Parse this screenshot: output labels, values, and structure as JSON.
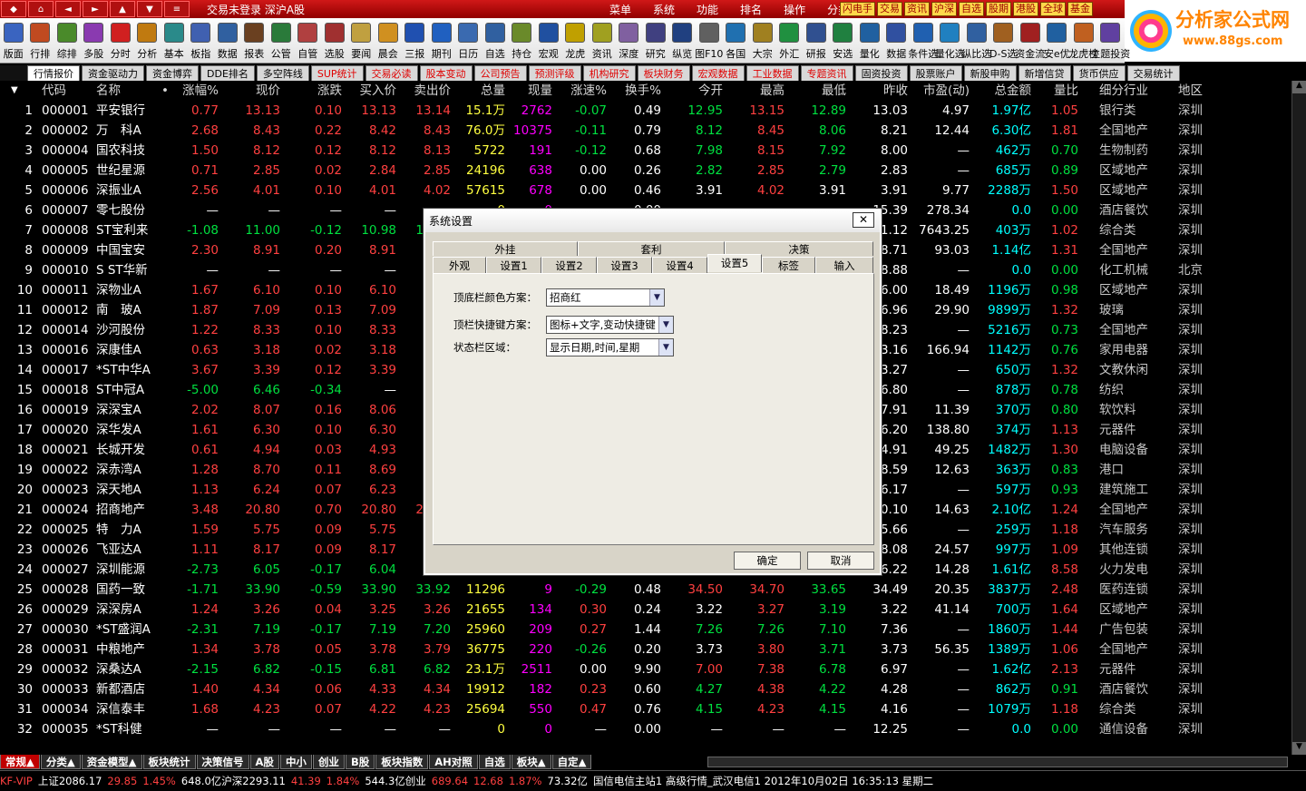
{
  "titlebar": {
    "app_title": "交易未登录   深沪A股",
    "nav_buttons": [
      "◆",
      "⌂",
      "◄",
      "►",
      "▲",
      "▼",
      "≡"
    ],
    "menus": [
      "菜单",
      "系统",
      "功能",
      "排名",
      "操作",
      "分类"
    ],
    "quick_buttons": [
      "闪电手",
      "交易",
      "资讯",
      "沪深",
      "自选",
      "股期",
      "港股",
      "全球",
      "基金"
    ]
  },
  "logo": {
    "name": "分析家公式网",
    "url": "www.88gs.com"
  },
  "toolbar": [
    {
      "label": "版面",
      "color": "#3a64c0"
    },
    {
      "label": "行排",
      "color": "#c04a20"
    },
    {
      "label": "综排",
      "color": "#4a8a2a"
    },
    {
      "label": "多股",
      "color": "#8a3ab0"
    },
    {
      "label": "分时",
      "color": "#d02020"
    },
    {
      "label": "分析",
      "color": "#c07a10"
    },
    {
      "label": "基本",
      "color": "#2a8a8a"
    },
    {
      "label": "板指",
      "color": "#4060b0"
    },
    {
      "label": "数据",
      "color": "#3060a0"
    },
    {
      "label": "报表",
      "color": "#6a4020"
    },
    {
      "label": "公管",
      "color": "#2a7a3a"
    },
    {
      "label": "自管",
      "color": "#b04040"
    },
    {
      "label": "选股",
      "color": "#a03030"
    },
    {
      "label": "要闻",
      "color": "#c0a040"
    },
    {
      "label": "晨会",
      "color": "#d09020"
    },
    {
      "label": "三报",
      "color": "#2050b0"
    },
    {
      "label": "期刊",
      "color": "#2060c0"
    },
    {
      "label": "日历",
      "color": "#3a6ab0"
    },
    {
      "label": "自选",
      "color": "#3060a0"
    },
    {
      "label": "持仓",
      "color": "#6a8a2a"
    },
    {
      "label": "宏观",
      "color": "#2050a0"
    },
    {
      "label": "龙虎",
      "color": "#c0a000"
    },
    {
      "label": "资讯",
      "color": "#a0a020"
    },
    {
      "label": "深度",
      "color": "#8060a0"
    },
    {
      "label": "研究",
      "color": "#404080"
    },
    {
      "label": "纵览",
      "color": "#204080"
    },
    {
      "label": "图F10",
      "color": "#606060"
    },
    {
      "label": "各国",
      "color": "#2070b0"
    },
    {
      "label": "大宗",
      "color": "#a08020"
    },
    {
      "label": "外汇",
      "color": "#209040"
    },
    {
      "label": "研报",
      "color": "#305090"
    },
    {
      "label": "安选",
      "color": "#208040"
    },
    {
      "label": "量化",
      "color": "#2060a0"
    },
    {
      "label": "数据",
      "color": "#3050a0"
    },
    {
      "label": "条件选",
      "color": "#2060b0"
    },
    {
      "label": "量化选",
      "color": "#2080c0"
    },
    {
      "label": "纵比选",
      "color": "#3060a0"
    },
    {
      "label": "D-S选",
      "color": "#a06020"
    },
    {
      "label": "资金流",
      "color": "#a02020"
    },
    {
      "label": "安e优",
      "color": "#2060a0"
    },
    {
      "label": "龙虎榜",
      "color": "#c06020"
    },
    {
      "label": "主题投资",
      "color": "#6040a0"
    }
  ],
  "tabs": [
    {
      "label": "行情报价",
      "active": true,
      "red": false
    },
    {
      "label": "资金驱动力",
      "active": false,
      "red": false
    },
    {
      "label": "资金博弈",
      "active": false,
      "red": false
    },
    {
      "label": "DDE排名",
      "active": false,
      "red": false
    },
    {
      "label": "多空阵线",
      "active": false,
      "red": false
    },
    {
      "label": "SUP统计",
      "active": false,
      "red": true
    },
    {
      "label": "交易必读",
      "active": false,
      "red": true
    },
    {
      "label": "股本变动",
      "active": false,
      "red": true
    },
    {
      "label": "公司预告",
      "active": false,
      "red": true
    },
    {
      "label": "预测评级",
      "active": false,
      "red": true
    },
    {
      "label": "机构研究",
      "active": false,
      "red": true
    },
    {
      "label": "板块财务",
      "active": false,
      "red": true
    },
    {
      "label": "宏观数据",
      "active": false,
      "red": true
    },
    {
      "label": "工业数据",
      "active": false,
      "red": true
    },
    {
      "label": "专题资讯",
      "active": false,
      "red": true
    },
    {
      "label": "固资投资",
      "active": false,
      "red": false
    },
    {
      "label": "股票账户",
      "active": false,
      "red": false
    },
    {
      "label": "新股申购",
      "active": false,
      "red": false
    },
    {
      "label": "新增信贷",
      "active": false,
      "red": false
    },
    {
      "label": "货币供应",
      "active": false,
      "red": false
    },
    {
      "label": "交易统计",
      "active": false,
      "red": false
    }
  ],
  "table": {
    "columns": [
      "",
      "代码",
      "名称",
      "•",
      "涨幅%",
      "现价",
      "涨跌",
      "买入价",
      "卖出价",
      "总量",
      "现量",
      "涨速%",
      "换手%",
      "今开",
      "最高",
      "最低",
      "昨收",
      "市盈(动)",
      "总金额",
      "量比",
      "细分行业",
      "地区"
    ],
    "rows": [
      [
        "1",
        "000001",
        "平安银行",
        "0.77",
        "13.13",
        "0.10",
        "13.13",
        "13.14",
        "15.1万",
        "2762",
        "-0.07",
        "0.49",
        "12.95",
        "13.15",
        "12.89",
        "13.03",
        "4.97",
        "1.97亿",
        "1.05",
        "银行类",
        "深圳"
      ],
      [
        "2",
        "000002",
        "万　科A",
        "2.68",
        "8.43",
        "0.22",
        "8.42",
        "8.43",
        "76.0万",
        "10375",
        "-0.11",
        "0.79",
        "8.12",
        "8.45",
        "8.06",
        "8.21",
        "12.44",
        "6.30亿",
        "1.81",
        "全国地产",
        "深圳"
      ],
      [
        "3",
        "000004",
        "国农科技",
        "1.50",
        "8.12",
        "0.12",
        "8.12",
        "8.13",
        "5722",
        "191",
        "-0.12",
        "0.68",
        "7.98",
        "8.15",
        "7.92",
        "8.00",
        "—",
        "462万",
        "0.70",
        "生物制药",
        "深圳"
      ],
      [
        "4",
        "000005",
        "世纪星源",
        "0.71",
        "2.85",
        "0.02",
        "2.84",
        "2.85",
        "24196",
        "638",
        "0.00",
        "0.26",
        "2.82",
        "2.85",
        "2.79",
        "2.83",
        "—",
        "685万",
        "0.89",
        "区域地产",
        "深圳"
      ],
      [
        "5",
        "000006",
        "深振业A",
        "2.56",
        "4.01",
        "0.10",
        "4.01",
        "4.02",
        "57615",
        "678",
        "0.00",
        "0.46",
        "3.91",
        "4.02",
        "3.91",
        "3.91",
        "9.77",
        "2288万",
        "1.50",
        "区域地产",
        "深圳"
      ],
      [
        "6",
        "000007",
        "零七股份",
        "—",
        "—",
        "—",
        "—",
        "—",
        "0",
        "0",
        "—",
        "0.00",
        "—",
        "—",
        "—",
        "15.39",
        "278.34",
        "0.0",
        "0.00",
        "酒店餐饮",
        "深圳"
      ],
      [
        "7",
        "000008",
        "ST宝利来",
        "-1.08",
        "11.00",
        "-0.12",
        "10.98",
        "11.00",
        "—",
        "—",
        "—",
        "—",
        "—",
        "—",
        "—",
        "11.12",
        "7643.25",
        "403万",
        "1.02",
        "综合类",
        "深圳"
      ],
      [
        "8",
        "000009",
        "中国宝安",
        "2.30",
        "8.91",
        "0.20",
        "8.91",
        "8.92",
        "—",
        "—",
        "—",
        "—",
        "—",
        "—",
        "—",
        "8.71",
        "93.03",
        "1.14亿",
        "1.31",
        "全国地产",
        "深圳"
      ],
      [
        "9",
        "000010",
        "S ST华新",
        "—",
        "—",
        "—",
        "—",
        "—",
        "—",
        "—",
        "—",
        "—",
        "—",
        "—",
        "—",
        "8.88",
        "—",
        "0.0",
        "0.00",
        "化工机械",
        "北京"
      ],
      [
        "10",
        "000011",
        "深物业A",
        "1.67",
        "6.10",
        "0.10",
        "6.10",
        "6.11",
        "—",
        "—",
        "—",
        "—",
        "—",
        "—",
        "—",
        "6.00",
        "18.49",
        "1196万",
        "0.98",
        "区域地产",
        "深圳"
      ],
      [
        "11",
        "000012",
        "南　玻A",
        "1.87",
        "7.09",
        "0.13",
        "7.09",
        "7.10",
        "—",
        "—",
        "—",
        "—",
        "—",
        "—",
        "—",
        "6.96",
        "29.90",
        "9899万",
        "1.32",
        "玻璃",
        "深圳"
      ],
      [
        "12",
        "000014",
        "沙河股份",
        "1.22",
        "8.33",
        "0.10",
        "8.33",
        "8.34",
        "—",
        "—",
        "—",
        "—",
        "—",
        "—",
        "—",
        "8.23",
        "—",
        "5216万",
        "0.73",
        "全国地产",
        "深圳"
      ],
      [
        "13",
        "000016",
        "深康佳A",
        "0.63",
        "3.18",
        "0.02",
        "3.18",
        "3.19",
        "—",
        "—",
        "—",
        "—",
        "—",
        "—",
        "—",
        "3.16",
        "166.94",
        "1142万",
        "0.76",
        "家用电器",
        "深圳"
      ],
      [
        "14",
        "000017",
        "*ST中华A",
        "3.67",
        "3.39",
        "0.12",
        "3.39",
        "3.40",
        "—",
        "—",
        "—",
        "—",
        "—",
        "—",
        "—",
        "3.27",
        "—",
        "650万",
        "1.32",
        "文教休闲",
        "深圳"
      ],
      [
        "15",
        "000018",
        "ST中冠A",
        "-5.00",
        "6.46",
        "-0.34",
        "—",
        "—",
        "—",
        "—",
        "—",
        "—",
        "—",
        "—",
        "—",
        "6.80",
        "—",
        "878万",
        "0.78",
        "纺织",
        "深圳"
      ],
      [
        "16",
        "000019",
        "深深宝A",
        "2.02",
        "8.07",
        "0.16",
        "8.06",
        "8.07",
        "—",
        "—",
        "—",
        "—",
        "—",
        "—",
        "—",
        "7.91",
        "11.39",
        "370万",
        "0.80",
        "软饮料",
        "深圳"
      ],
      [
        "17",
        "000020",
        "深华发A",
        "1.61",
        "6.30",
        "0.10",
        "6.30",
        "6.31",
        "—",
        "—",
        "—",
        "—",
        "—",
        "—",
        "—",
        "6.20",
        "138.80",
        "374万",
        "1.13",
        "元器件",
        "深圳"
      ],
      [
        "18",
        "000021",
        "长城开发",
        "0.61",
        "4.94",
        "0.03",
        "4.93",
        "4.94",
        "—",
        "—",
        "—",
        "—",
        "—",
        "—",
        "—",
        "4.91",
        "49.25",
        "1482万",
        "1.30",
        "电脑设备",
        "深圳"
      ],
      [
        "19",
        "000022",
        "深赤湾A",
        "1.28",
        "8.70",
        "0.11",
        "8.69",
        "8.70",
        "—",
        "—",
        "—",
        "—",
        "—",
        "—",
        "—",
        "8.59",
        "12.63",
        "363万",
        "0.83",
        "港口",
        "深圳"
      ],
      [
        "20",
        "000023",
        "深天地A",
        "1.13",
        "6.24",
        "0.07",
        "6.23",
        "6.24",
        "—",
        "—",
        "—",
        "—",
        "—",
        "—",
        "—",
        "6.17",
        "—",
        "597万",
        "0.93",
        "建筑施工",
        "深圳"
      ],
      [
        "21",
        "000024",
        "招商地产",
        "3.48",
        "20.80",
        "0.70",
        "20.80",
        "20.81",
        "—",
        "—",
        "—",
        "—",
        "—",
        "—",
        "—",
        "20.10",
        "14.63",
        "2.10亿",
        "1.24",
        "全国地产",
        "深圳"
      ],
      [
        "22",
        "000025",
        "特　力A",
        "1.59",
        "5.75",
        "0.09",
        "5.75",
        "5.76",
        "—",
        "—",
        "—",
        "—",
        "—",
        "—",
        "—",
        "5.66",
        "—",
        "259万",
        "1.18",
        "汽车服务",
        "深圳"
      ],
      [
        "23",
        "000026",
        "飞亚达A",
        "1.11",
        "8.17",
        "0.09",
        "8.17",
        "8.18",
        "—",
        "—",
        "—",
        "—",
        "—",
        "—",
        "—",
        "8.08",
        "24.57",
        "997万",
        "1.09",
        "其他连锁",
        "深圳"
      ],
      [
        "24",
        "000027",
        "深圳能源",
        "-2.73",
        "6.05",
        "-0.17",
        "6.04",
        "6.05",
        "—",
        "—",
        "—",
        "—",
        "—",
        "—",
        "—",
        "6.22",
        "14.28",
        "1.61亿",
        "8.58",
        "火力发电",
        "深圳"
      ],
      [
        "25",
        "000028",
        "国药一致",
        "-1.71",
        "33.90",
        "-0.59",
        "33.90",
        "33.92",
        "11296",
        "9",
        "-0.29",
        "0.48",
        "34.50",
        "34.70",
        "33.65",
        "34.49",
        "20.35",
        "3837万",
        "2.48",
        "医药连锁",
        "深圳"
      ],
      [
        "26",
        "000029",
        "深深房A",
        "1.24",
        "3.26",
        "0.04",
        "3.25",
        "3.26",
        "21655",
        "134",
        "0.30",
        "0.24",
        "3.22",
        "3.27",
        "3.19",
        "3.22",
        "41.14",
        "700万",
        "1.64",
        "区域地产",
        "深圳"
      ],
      [
        "27",
        "000030",
        "*ST盛润A",
        "-2.31",
        "7.19",
        "-0.17",
        "7.19",
        "7.20",
        "25960",
        "209",
        "0.27",
        "1.44",
        "7.26",
        "7.26",
        "7.10",
        "7.36",
        "—",
        "1860万",
        "1.44",
        "广告包装",
        "深圳"
      ],
      [
        "28",
        "000031",
        "中粮地产",
        "1.34",
        "3.78",
        "0.05",
        "3.78",
        "3.79",
        "36775",
        "220",
        "-0.26",
        "0.20",
        "3.73",
        "3.80",
        "3.71",
        "3.73",
        "56.35",
        "1389万",
        "1.06",
        "全国地产",
        "深圳"
      ],
      [
        "29",
        "000032",
        "深桑达A",
        "-2.15",
        "6.82",
        "-0.15",
        "6.81",
        "6.82",
        "23.1万",
        "2511",
        "0.00",
        "9.90",
        "7.00",
        "7.38",
        "6.78",
        "6.97",
        "—",
        "1.62亿",
        "2.13",
        "元器件",
        "深圳"
      ],
      [
        "30",
        "000033",
        "新都酒店",
        "1.40",
        "4.34",
        "0.06",
        "4.33",
        "4.34",
        "19912",
        "182",
        "0.23",
        "0.60",
        "4.27",
        "4.38",
        "4.22",
        "4.28",
        "—",
        "862万",
        "0.91",
        "酒店餐饮",
        "深圳"
      ],
      [
        "31",
        "000034",
        "深信泰丰",
        "1.68",
        "4.23",
        "0.07",
        "4.22",
        "4.23",
        "25694",
        "550",
        "0.47",
        "0.76",
        "4.15",
        "4.23",
        "4.15",
        "4.16",
        "—",
        "1079万",
        "1.18",
        "综合类",
        "深圳"
      ],
      [
        "32",
        "000035",
        "*ST科健",
        "—",
        "—",
        "—",
        "—",
        "—",
        "0",
        "0",
        "—",
        "0.00",
        "—",
        "—",
        "—",
        "12.25",
        "—",
        "0.0",
        "0.00",
        "通信设备",
        "深圳"
      ]
    ]
  },
  "bottom_tabs": [
    {
      "label": "常规▲",
      "active": true
    },
    {
      "label": "分类▲",
      "active": false
    },
    {
      "label": "资金模型▲",
      "active": false
    },
    {
      "label": "板块统计",
      "active": false
    },
    {
      "label": "决策信号",
      "active": false
    },
    {
      "label": "A股",
      "active": false
    },
    {
      "label": "中小",
      "active": false
    },
    {
      "label": "创业",
      "active": false
    },
    {
      "label": "B股",
      "active": false
    },
    {
      "label": "板块指数",
      "active": false
    },
    {
      "label": "AH对照",
      "active": false
    },
    {
      "label": "自选",
      "active": false
    },
    {
      "label": "板块▲",
      "active": false
    },
    {
      "label": "自定▲",
      "active": false
    }
  ],
  "statusbar": [
    {
      "text": "KF-VIP",
      "color": "#ff4040"
    },
    {
      "text": "上证2086.17",
      "color": "#ffffff"
    },
    {
      "text": "29.85",
      "color": "#ff4040"
    },
    {
      "text": "1.45%",
      "color": "#ff4040"
    },
    {
      "text": "648.0亿沪深2293.11",
      "color": "#ffffff"
    },
    {
      "text": "41.39",
      "color": "#ff4040"
    },
    {
      "text": "1.84%",
      "color": "#ff4040"
    },
    {
      "text": "544.3亿创业",
      "color": "#ffffff"
    },
    {
      "text": "689.64",
      "color": "#ff4040"
    },
    {
      "text": "12.68",
      "color": "#ff4040"
    },
    {
      "text": "1.87%",
      "color": "#ff4040"
    },
    {
      "text": "73.32亿",
      "color": "#ffffff"
    },
    {
      "text": "国信电信主站1  高级行情_武汉电信1  2012年10月02日  16:35:13  星期二",
      "color": "#ffffff"
    }
  ],
  "dialog": {
    "title": "系统设置",
    "close": "✕",
    "tabs_row1": [
      "外挂",
      "套利",
      "决策"
    ],
    "tabs_row2": [
      "外观",
      "设置1",
      "设置2",
      "设置3",
      "设置4",
      "设置5",
      "标签",
      "输入"
    ],
    "active_tab": "设置5",
    "fields": [
      {
        "label": "顶底栏颜色方案：",
        "value": "招商红"
      },
      {
        "label": "顶栏快捷键方案：",
        "value": "图标+文字,变动快捷键"
      },
      {
        "label": "状态栏区域：",
        "value": "显示日期,时间,星期"
      }
    ],
    "ok": "确定",
    "cancel": "取消"
  }
}
